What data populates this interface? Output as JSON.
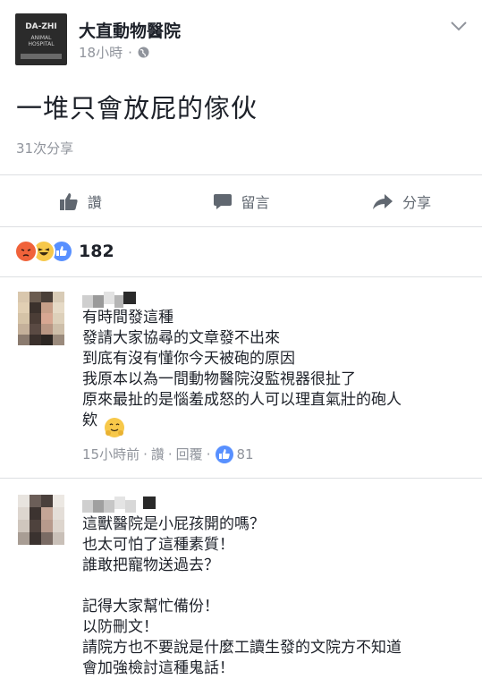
{
  "post": {
    "page_name": "大直動物醫院",
    "time": "18小時",
    "dot": "·",
    "text": "一堆只會放屁的傢伙",
    "share_count": "31次分享",
    "logo_text": "DA-ZHI",
    "logo_sub": "ANIMAL HOSPITAL"
  },
  "actions": {
    "like": "讚",
    "comment": "留言",
    "share": "分享"
  },
  "reactions": {
    "icons": [
      "angry-icon",
      "haha-icon",
      "like-icon"
    ],
    "count": "182"
  },
  "comments": [
    {
      "lines": "有時間發這種\n發請大家協尋的文章發不出來\n到底有沒有懂你今天被砲的原因\n我原本以為一間動物醫院沒監視器很扯了\n原來最扯的是惱羞成怒的人可以理直氣壯的砲人\n欸",
      "time": "15小時前",
      "like": "讚",
      "reply": "回覆",
      "likes": "81"
    },
    {
      "lines": "這獸醫院是小屁孩開的嗎？\n也太可怕了這種素質！\n誰敢把寵物送過去？\n\n記得大家幫忙備份！\n以防刪文！\n請院方也不要說是什麼工讀生發的文院方不知道\n會加強檢討這種鬼話！"
    }
  ],
  "colors": {
    "text": "#1d2129",
    "meta": "#90949c",
    "like_blue": "#5890ff",
    "angry": "#f0623a",
    "haha": "#f7c84a"
  }
}
